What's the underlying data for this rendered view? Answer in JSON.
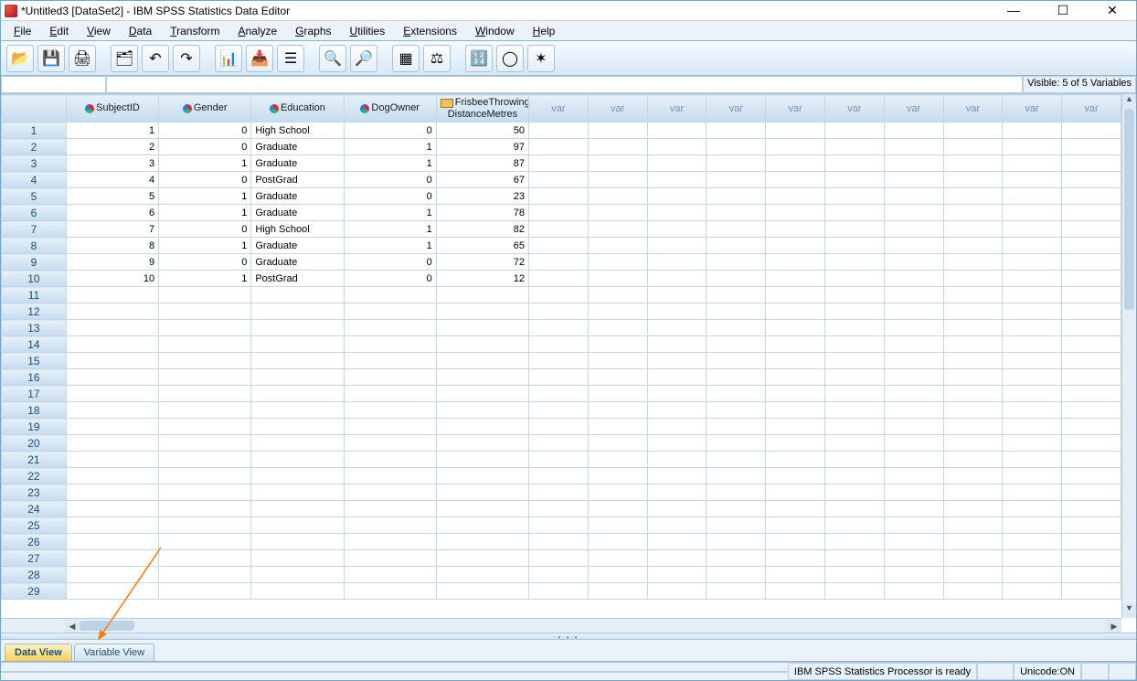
{
  "window": {
    "title": "*Untitled3 [DataSet2] - IBM SPSS Statistics Data Editor",
    "minimize": "—",
    "maximize": "☐",
    "close": "✕"
  },
  "menu": [
    "File",
    "Edit",
    "View",
    "Data",
    "Transform",
    "Analyze",
    "Graphs",
    "Utilities",
    "Extensions",
    "Window",
    "Help"
  ],
  "toolbar_icons": [
    {
      "name": "open-icon",
      "glyph": "📂"
    },
    {
      "name": "save-icon",
      "glyph": "💾"
    },
    {
      "name": "print-icon",
      "glyph": "🖨"
    },
    {
      "sep": true
    },
    {
      "name": "recall-dialog-icon",
      "glyph": "🗂"
    },
    {
      "name": "undo-icon",
      "glyph": "↶"
    },
    {
      "name": "redo-icon",
      "glyph": "↷"
    },
    {
      "sep": true
    },
    {
      "name": "goto-case-icon",
      "glyph": "📊"
    },
    {
      "name": "goto-variable-icon",
      "glyph": "📥"
    },
    {
      "name": "variables-icon",
      "glyph": "☰"
    },
    {
      "sep": true
    },
    {
      "name": "find-icon",
      "glyph": "🔍"
    },
    {
      "name": "insert-cases-icon",
      "glyph": "🔎"
    },
    {
      "sep": true
    },
    {
      "name": "split-file-icon",
      "glyph": "▦"
    },
    {
      "name": "weight-cases-icon",
      "glyph": "⚖"
    },
    {
      "sep": true
    },
    {
      "name": "select-cases-icon",
      "glyph": "🔢"
    },
    {
      "name": "value-labels-icon",
      "glyph": "◯"
    },
    {
      "name": "use-sets-icon",
      "glyph": "✶"
    }
  ],
  "visible_text": "Visible: 5 of 5 Variables",
  "columns": [
    {
      "name": "SubjectID",
      "type": "nominal"
    },
    {
      "name": "Gender",
      "type": "nominal"
    },
    {
      "name": "Education",
      "type": "nominal"
    },
    {
      "name": "DogOwner",
      "type": "nominal"
    },
    {
      "name": "FrisbeeThrowingDistanceMetres",
      "type": "scale"
    }
  ],
  "empty_col_label": "var",
  "empty_col_count": 10,
  "data_rows": [
    {
      "SubjectID": "1",
      "Gender": "0",
      "Education": "High School",
      "DogOwner": "0",
      "Frisbee": "50"
    },
    {
      "SubjectID": "2",
      "Gender": "0",
      "Education": "Graduate",
      "DogOwner": "1",
      "Frisbee": "97"
    },
    {
      "SubjectID": "3",
      "Gender": "1",
      "Education": "Graduate",
      "DogOwner": "1",
      "Frisbee": "87"
    },
    {
      "SubjectID": "4",
      "Gender": "0",
      "Education": "PostGrad",
      "DogOwner": "0",
      "Frisbee": "67"
    },
    {
      "SubjectID": "5",
      "Gender": "1",
      "Education": "Graduate",
      "DogOwner": "0",
      "Frisbee": "23"
    },
    {
      "SubjectID": "6",
      "Gender": "1",
      "Education": "Graduate",
      "DogOwner": "1",
      "Frisbee": "78"
    },
    {
      "SubjectID": "7",
      "Gender": "0",
      "Education": "High School",
      "DogOwner": "1",
      "Frisbee": "82"
    },
    {
      "SubjectID": "8",
      "Gender": "1",
      "Education": "Graduate",
      "DogOwner": "1",
      "Frisbee": "65"
    },
    {
      "SubjectID": "9",
      "Gender": "0",
      "Education": "Graduate",
      "DogOwner": "0",
      "Frisbee": "72"
    },
    {
      "SubjectID": "10",
      "Gender": "1",
      "Education": "PostGrad",
      "DogOwner": "0",
      "Frisbee": "12"
    }
  ],
  "total_rows_visible": 29,
  "tabs": {
    "data_view": "Data View",
    "variable_view": "Variable View"
  },
  "status": {
    "processor": "IBM SPSS Statistics Processor is ready",
    "unicode": "Unicode:ON"
  }
}
